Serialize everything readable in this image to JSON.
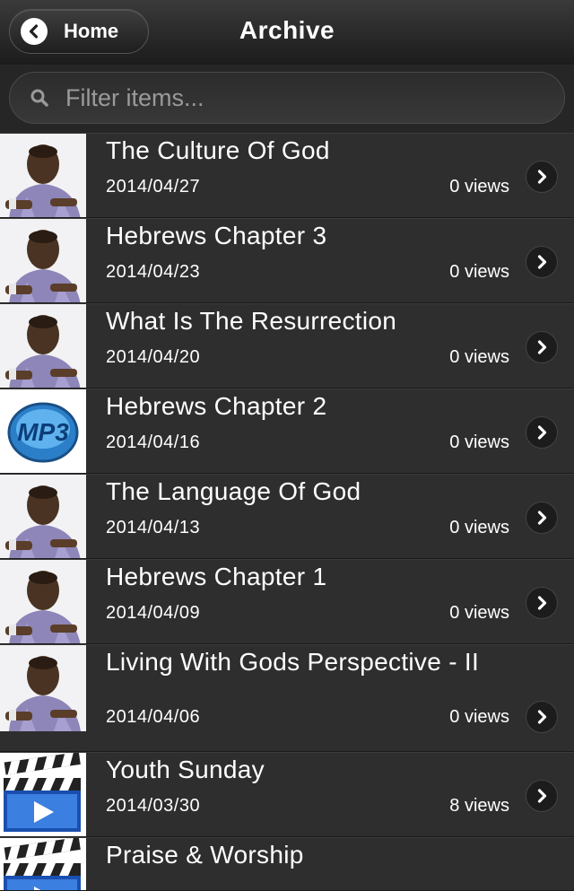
{
  "navbar": {
    "back_label": "Home",
    "title": "Archive",
    "back_icon": "chevron-left-icon"
  },
  "search": {
    "placeholder": "Filter items...",
    "value": "",
    "icon": "search-icon"
  },
  "items": [
    {
      "title": "The Culture Of God",
      "date": "2014/04/27",
      "views": "0 views",
      "thumbnail": "person-photo"
    },
    {
      "title": "Hebrews Chapter 3",
      "date": "2014/04/23",
      "views": "0 views",
      "thumbnail": "person-photo"
    },
    {
      "title": "What Is The Resurrection",
      "date": "2014/04/20",
      "views": "0 views",
      "thumbnail": "person-photo"
    },
    {
      "title": "Hebrews Chapter 2",
      "date": "2014/04/16",
      "views": "0 views",
      "thumbnail": "mp3-icon"
    },
    {
      "title": "The Language Of God",
      "date": "2014/04/13",
      "views": "0 views",
      "thumbnail": "person-photo"
    },
    {
      "title": "Hebrews Chapter 1",
      "date": "2014/04/09",
      "views": "0 views",
      "thumbnail": "person-photo"
    },
    {
      "title": "Living With Gods Perspective - II",
      "date": "2014/04/06",
      "views": "0 views",
      "thumbnail": "person-photo"
    },
    {
      "title": "Youth Sunday",
      "date": "2014/03/30",
      "views": "8 views",
      "thumbnail": "video-clapper-icon"
    },
    {
      "title": "Praise & Worship",
      "date": "",
      "views": "",
      "thumbnail": "video-clapper-icon"
    }
  ],
  "colors": {
    "background": "#2e2e2e",
    "navbar": "#1c1c1c",
    "text": "#ffffff"
  }
}
